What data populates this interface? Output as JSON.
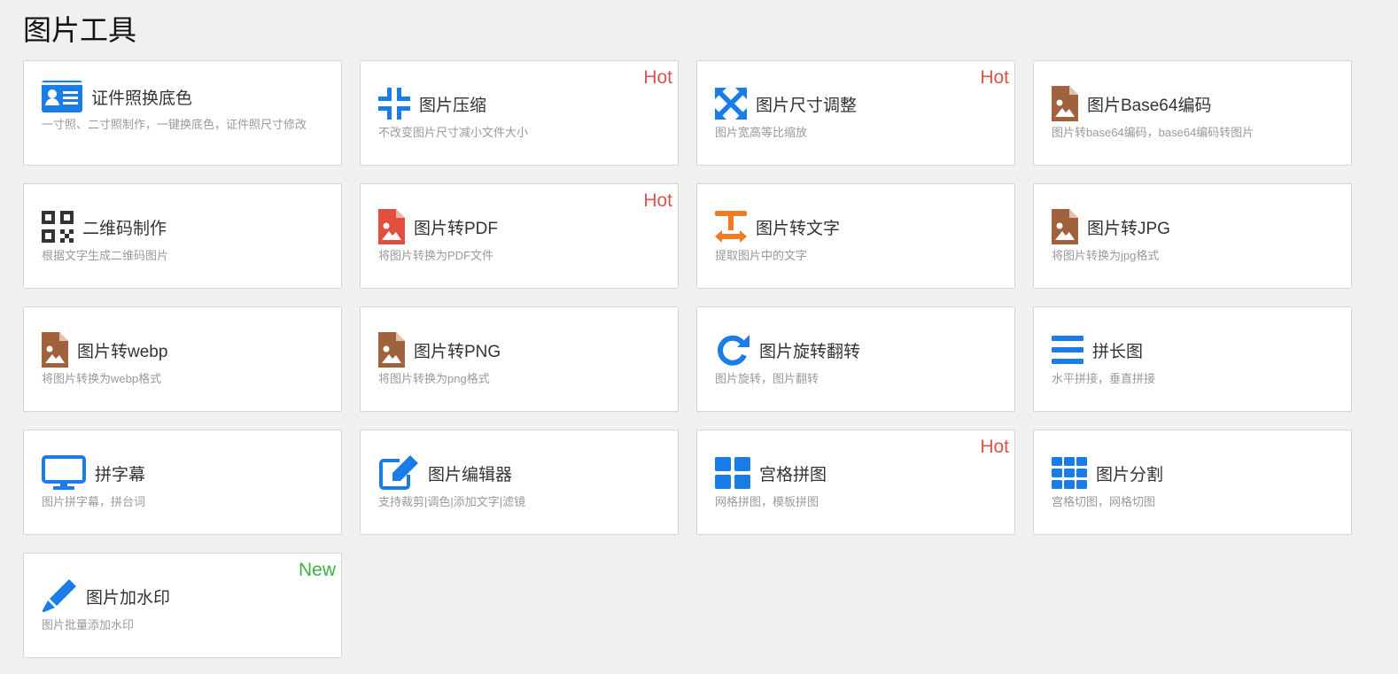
{
  "page": {
    "title": "图片工具"
  },
  "colors": {
    "hot": "#d9534f",
    "new": "#3cb043",
    "blue": "#1a7ce6",
    "brown": "#a0623c",
    "red": "#e34f3e",
    "orange": "#ef7b22",
    "dark": "#333333"
  },
  "tools": [
    {
      "title": "证件照换底色",
      "desc": "一寸照、二寸照制作，一键换底色，证件照尺寸修改",
      "badge": "",
      "icon": "id-card-icon"
    },
    {
      "title": "图片压缩",
      "desc": "不改变图片尺寸减小文件大小",
      "badge": "Hot",
      "icon": "compress-icon"
    },
    {
      "title": "图片尺寸调整",
      "desc": "图片宽高等比缩放",
      "badge": "Hot",
      "icon": "expand-arrows-icon"
    },
    {
      "title": "图片Base64编码",
      "desc": "图片转base64编码，base64编码转图片",
      "badge": "",
      "icon": "image-file-icon"
    },
    {
      "title": "二维码制作",
      "desc": "根据文字生成二维码图片",
      "badge": "",
      "icon": "qrcode-icon"
    },
    {
      "title": "图片转PDF",
      "desc": "将图片转换为PDF文件",
      "badge": "Hot",
      "icon": "pdf-file-icon"
    },
    {
      "title": "图片转文字",
      "desc": "提取图片中的文字",
      "badge": "",
      "icon": "text-width-icon"
    },
    {
      "title": "图片转JPG",
      "desc": "将图片转换为jpg格式",
      "badge": "",
      "icon": "image-file-icon"
    },
    {
      "title": "图片转webp",
      "desc": "将图片转换为webp格式",
      "badge": "",
      "icon": "image-file-icon"
    },
    {
      "title": "图片转PNG",
      "desc": "将图片转换为png格式",
      "badge": "",
      "icon": "image-file-icon"
    },
    {
      "title": "图片旋转翻转",
      "desc": "图片旋转，图片翻转",
      "badge": "",
      "icon": "rotate-icon"
    },
    {
      "title": "拼长图",
      "desc": "水平拼接，垂直拼接",
      "badge": "",
      "icon": "bars-icon"
    },
    {
      "title": "拼字幕",
      "desc": "图片拼字幕，拼台词",
      "badge": "",
      "icon": "monitor-icon"
    },
    {
      "title": "图片编辑器",
      "desc": "支持裁剪|调色|添加文字|滤镜",
      "badge": "",
      "icon": "edit-icon"
    },
    {
      "title": "宫格拼图",
      "desc": "网格拼图，模板拼图",
      "badge": "Hot",
      "icon": "grid-2x2-icon"
    },
    {
      "title": "图片分割",
      "desc": "宫格切图，网格切图",
      "badge": "",
      "icon": "grid-3x3-icon"
    },
    {
      "title": "图片加水印",
      "desc": "图片批量添加水印",
      "badge": "New",
      "icon": "pencil-icon"
    }
  ]
}
